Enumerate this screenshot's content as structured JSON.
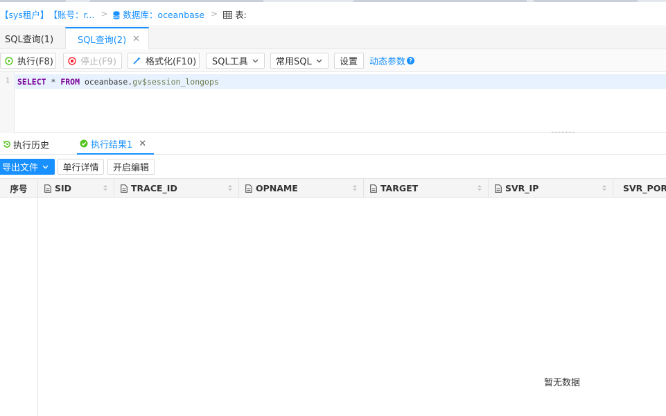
{
  "breadcrumb": {
    "tenant": "【sys租户】",
    "account": "【账号：r...",
    "database": "数据库：oceanbase",
    "table": "表:"
  },
  "tabs": [
    {
      "label": "SQL查询(1)",
      "active": false
    },
    {
      "label": "SQL查询(2)",
      "active": true
    }
  ],
  "toolbar": {
    "execute": "执行(F8)",
    "stop": "停止(F9)",
    "format": "格式化(F10)",
    "sql_tools": "SQL工具",
    "common_sql": "常用SQL",
    "settings": "设置",
    "dynamic_params": "动态参数"
  },
  "editor": {
    "line_number": "1",
    "tokens": {
      "select": "SELECT",
      "star": " * ",
      "from": "FROM",
      "schema": " oceanbase.",
      "table": "gv$session_longops"
    }
  },
  "result_tabs": [
    {
      "label": "执行历史",
      "active": false
    },
    {
      "label": "执行结果1",
      "active": true
    }
  ],
  "result_toolbar": {
    "export": "导出文件",
    "row_detail": "单行详情",
    "enable_edit": "开启编辑"
  },
  "grid": {
    "rownum_header": "序号",
    "columns": [
      "SID",
      "TRACE_ID",
      "OPNAME",
      "TARGET",
      "SVR_IP",
      "SVR_PORT"
    ],
    "empty_text": "暂无数据"
  },
  "colors": {
    "accent": "#1890ff",
    "keyword": "#7a0099",
    "stop_red": "#f5222d",
    "execute_green": "#52c41a"
  }
}
